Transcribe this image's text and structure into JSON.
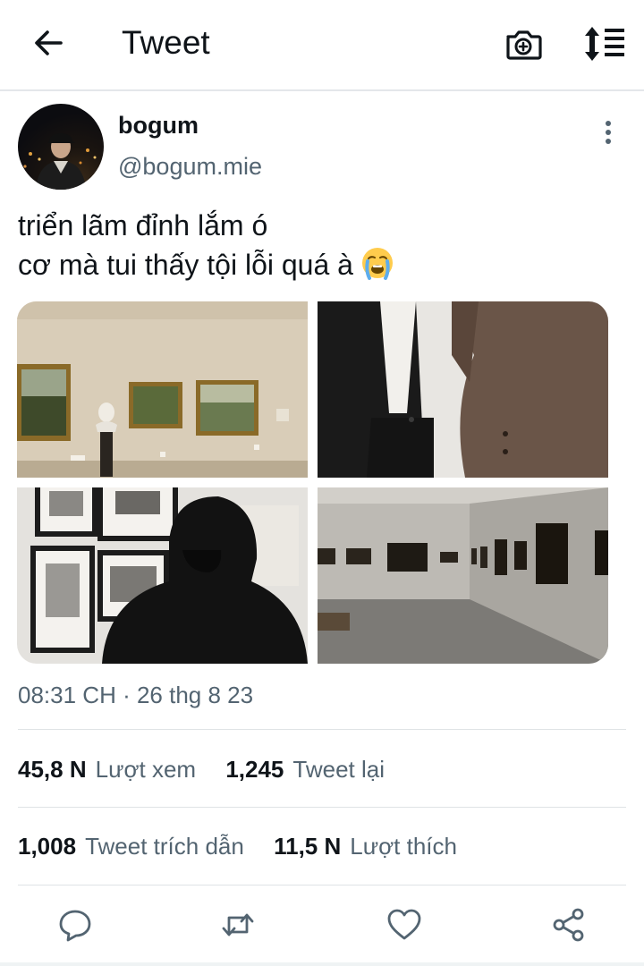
{
  "header": {
    "title": "Tweet",
    "back_icon": "arrow-left-icon",
    "camera_icon": "camera-plus-icon",
    "sort_icon": "sort-list-icon"
  },
  "tweet": {
    "display_name": "bogum",
    "handle": "@bogum.mie",
    "text_line1": "triển lãm đỉnh lắm ó",
    "text_line2": "cơ mà tui thấy tội lỗi quá à",
    "emoji": "loudly-crying-face",
    "timestamp": "08:31 CH · 26 thg 8 23"
  },
  "stats": {
    "views_num": "45,8 N",
    "views_label": "Lượt xem",
    "retweets_num": "1,245",
    "retweets_label": "Tweet lại",
    "quotes_num": "1,008",
    "quotes_label": "Tweet trích dẫn",
    "likes_num": "11,5 N",
    "likes_label": "Lượt thích"
  },
  "actions": [
    "reply-icon",
    "retweet-icon",
    "like-icon",
    "share-icon"
  ],
  "colors": {
    "text": "#0f1419",
    "secondary": "#536471",
    "divider": "#dfe3e6"
  }
}
